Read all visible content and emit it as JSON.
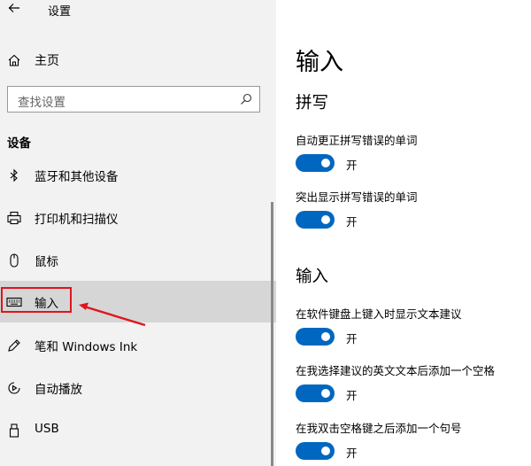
{
  "window": {
    "title": "设置"
  },
  "sidebar": {
    "home_label": "主页",
    "search_placeholder": "查找设置",
    "group_title": "设备",
    "items": [
      {
        "label": "蓝牙和其他设备",
        "icon": "bluetooth-icon"
      },
      {
        "label": "打印机和扫描仪",
        "icon": "printer-icon"
      },
      {
        "label": "鼠标",
        "icon": "mouse-icon"
      },
      {
        "label": "输入",
        "icon": "keyboard-icon",
        "selected": true
      },
      {
        "label": "笔和 Windows Ink",
        "icon": "pen-icon"
      },
      {
        "label": "自动播放",
        "icon": "autoplay-icon"
      },
      {
        "label": "USB",
        "icon": "usb-icon"
      }
    ]
  },
  "main": {
    "title": "输入",
    "sections": [
      {
        "title": "拼写",
        "settings": [
          {
            "label": "自动更正拼写错误的单词",
            "state": "开",
            "on": true
          },
          {
            "label": "突出显示拼写错误的单词",
            "state": "开",
            "on": true
          }
        ]
      },
      {
        "title": "输入",
        "settings": [
          {
            "label": "在软件键盘上键入时显示文本建议",
            "state": "开",
            "on": true
          },
          {
            "label": "在我选择建议的英文文本后添加一个空格",
            "state": "开",
            "on": true
          },
          {
            "label": "在我双击空格键之后添加一个句号",
            "state": "开",
            "on": true
          }
        ]
      }
    ]
  },
  "colors": {
    "accent": "#0067c0",
    "annotation": "#e0141e",
    "selected_bg": "#d6d6d6",
    "sidebar_bg": "#f2f2f2"
  }
}
